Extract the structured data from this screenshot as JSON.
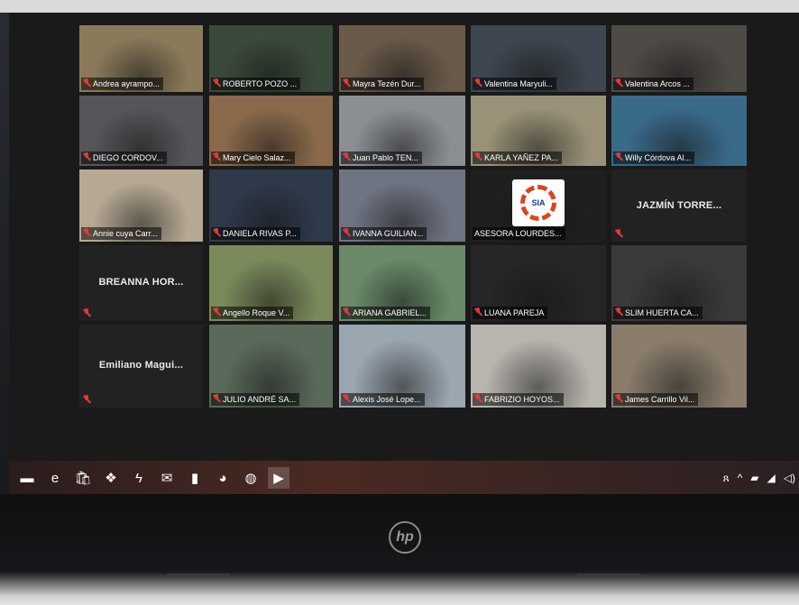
{
  "meeting": {
    "participants": [
      {
        "name": "Andrea ayrampo...",
        "muted": true,
        "color": "#8a7a5a"
      },
      {
        "name": "ROBERTO POZO ...",
        "muted": true,
        "color": "#3a4a3a"
      },
      {
        "name": "Mayra Tezén Dur...",
        "muted": true,
        "color": "#6a5a4a"
      },
      {
        "name": "Valentina Maryuli...",
        "muted": true,
        "color": "#3e4650"
      },
      {
        "name": "Valentina Arcos ...",
        "muted": true,
        "color": "#4e4a46"
      },
      {
        "name": "DIEGO CORDOV...",
        "muted": true,
        "color": "#55565a"
      },
      {
        "name": "Mary Cielo Salaz...",
        "muted": true,
        "color": "#8a6a4a"
      },
      {
        "name": "Juan Pablo TEN...",
        "muted": true,
        "color": "#8b8f94"
      },
      {
        "name": "KARLA YAÑEZ PA...",
        "muted": true,
        "color": "#9a9278"
      },
      {
        "name": "Willy Córdova Al...",
        "muted": true,
        "color": "#3a6a8a"
      },
      {
        "name": "Annie cuya Carr...",
        "muted": true,
        "color": "#b6a994"
      },
      {
        "name": "DANIELA RIVAS P...",
        "muted": true,
        "color": "#2e3a4a"
      },
      {
        "name": "IVANNA GUILIAN...",
        "muted": true,
        "color": "#6f7482"
      },
      {
        "name": "ASESORA LOURDES...",
        "muted": false,
        "color": "#1f1f1f",
        "logo": "SIA"
      },
      {
        "name": "JAZMÍN TORRE...",
        "muted": true,
        "name_only": true
      },
      {
        "name": "BREANNA HOR...",
        "muted": true,
        "name_only": true
      },
      {
        "name": "Angello Roque V...",
        "muted": true,
        "color": "#7a8a5a"
      },
      {
        "name": "ARIANA GABRIEL...",
        "muted": true,
        "color": "#6a8a6a"
      },
      {
        "name": "LUANA PAREJA",
        "muted": true,
        "color": "#262626"
      },
      {
        "name": "SLIM HUERTA CA...",
        "muted": true,
        "color": "#3a3a3a"
      },
      {
        "name": "Emiliano Magui...",
        "muted": true,
        "name_only": true
      },
      {
        "name": "JULIO ANDRÉ SA...",
        "muted": true,
        "color": "#5a6a5a"
      },
      {
        "name": "Alexis José Lope...",
        "muted": true,
        "color": "#9aa6b0"
      },
      {
        "name": "FABRIZIO HOYOS...",
        "muted": true,
        "color": "#b8b4ae"
      },
      {
        "name": "James Carrillo Vil...",
        "muted": true,
        "color": "#8a7d6c"
      }
    ]
  },
  "taskbar": {
    "apps": [
      {
        "icon": "file-explorer-icon",
        "glyph": "▬"
      },
      {
        "icon": "edge-icon",
        "glyph": "e"
      },
      {
        "icon": "store-icon",
        "glyph": "🛍"
      },
      {
        "icon": "dropbox-icon",
        "glyph": "❖"
      },
      {
        "icon": "power-automate-icon",
        "glyph": "ϟ"
      },
      {
        "icon": "mail-icon",
        "glyph": "✉"
      },
      {
        "icon": "office-icon",
        "glyph": "▮"
      },
      {
        "icon": "paint-icon",
        "glyph": "◕"
      },
      {
        "icon": "chrome-icon",
        "glyph": "◍"
      },
      {
        "icon": "zoom-icon",
        "glyph": "▶",
        "active": true
      }
    ],
    "tray": {
      "people": "ጸ",
      "chevron": "^",
      "network": "▰",
      "wifi": "◢",
      "volume": "◁)"
    }
  },
  "device": {
    "brand": "hp"
  }
}
